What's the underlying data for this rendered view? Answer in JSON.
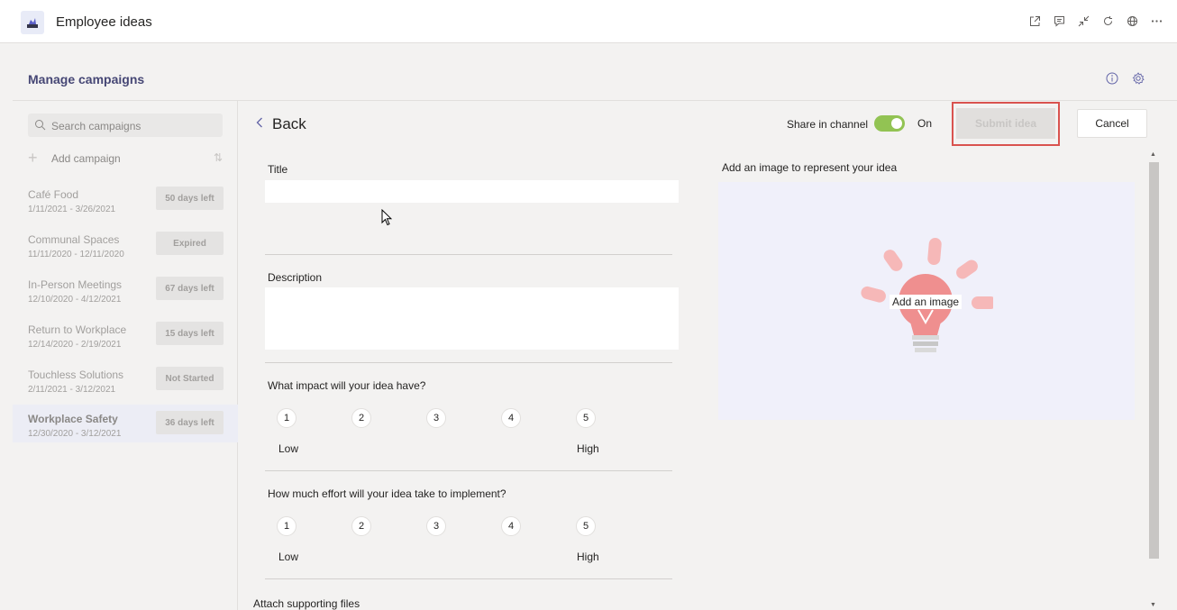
{
  "app": {
    "title": "Employee ideas"
  },
  "top_actions": [
    "popout-icon",
    "chat-icon",
    "collapse-icon",
    "refresh-icon",
    "globe-icon",
    "more-icon"
  ],
  "header": {
    "title": "Manage campaigns"
  },
  "sidebar": {
    "search_placeholder": "Search campaigns",
    "add_label": "Add campaign",
    "campaigns": [
      {
        "name": "Café Food",
        "dates": "1/11/2021 - 3/26/2021",
        "status": "50 days left"
      },
      {
        "name": "Communal Spaces",
        "dates": "11/11/2020 - 12/11/2020",
        "status": "Expired"
      },
      {
        "name": "In-Person Meetings",
        "dates": "12/10/2020 - 4/12/2021",
        "status": "67 days left"
      },
      {
        "name": "Return to Workplace",
        "dates": "12/14/2020 - 2/19/2021",
        "status": "15 days left"
      },
      {
        "name": "Touchless Solutions",
        "dates": "2/11/2021 - 3/12/2021",
        "status": "Not Started"
      },
      {
        "name": "Workplace Safety",
        "dates": "12/30/2020 - 3/12/2021",
        "status": "36 days left",
        "selected": true
      }
    ]
  },
  "form": {
    "back_label": "Back",
    "share_label": "Share in channel",
    "share_state": "On",
    "submit_label": "Submit idea",
    "cancel_label": "Cancel",
    "title_label": "Title",
    "title_value": "",
    "description_label": "Description",
    "description_value": "",
    "impact_question": "What impact will your idea have?",
    "effort_question": "How much effort will your idea take to implement?",
    "scale": [
      "1",
      "2",
      "3",
      "4",
      "5"
    ],
    "low_label": "Low",
    "high_label": "High",
    "image_label": "Add an image to represent your idea",
    "image_button": "Add an image",
    "attach_label": "Attach supporting files"
  },
  "colors": {
    "accent": "#6264a7",
    "toggle_on": "#92c353",
    "highlight": "#d9534f"
  }
}
